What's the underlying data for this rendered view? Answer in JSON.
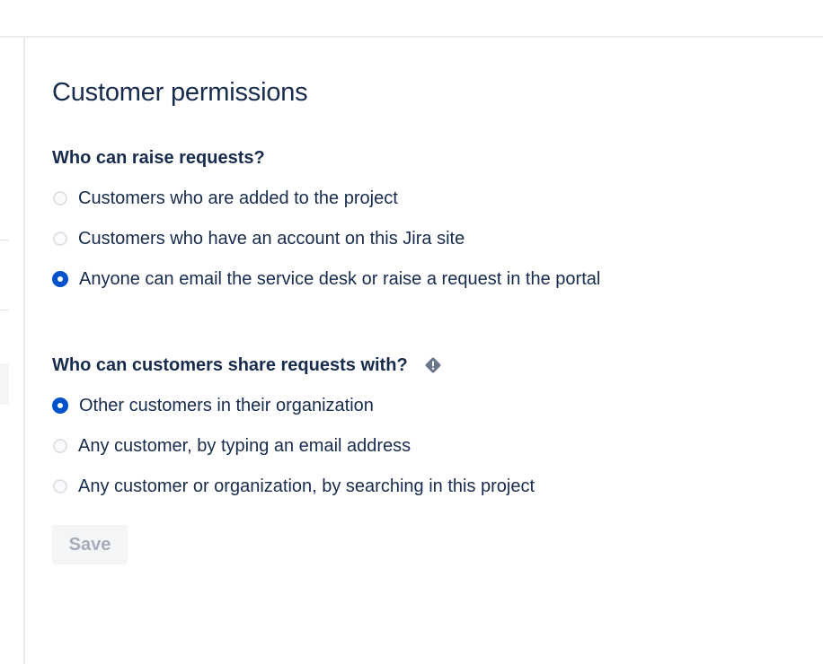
{
  "page": {
    "title": "Customer permissions"
  },
  "raise_requests": {
    "heading": "Who can raise requests?",
    "options": [
      {
        "label": "Customers who are added to the project",
        "selected": false
      },
      {
        "label": "Customers who have an account on this Jira site",
        "selected": false
      },
      {
        "label": "Anyone can email the service desk or raise a request in the portal",
        "selected": true
      }
    ]
  },
  "share_requests": {
    "heading": "Who can customers share requests with?",
    "heading_icon": "warning-diamond-icon",
    "options": [
      {
        "label": "Other customers in their organization",
        "selected": true
      },
      {
        "label": "Any customer, by typing an email address",
        "selected": false
      },
      {
        "label": "Any customer or organization, by searching in this project",
        "selected": false
      }
    ]
  },
  "actions": {
    "save_label": "Save",
    "save_disabled": true
  },
  "colors": {
    "text": "#172b4d",
    "accent": "#0052cc",
    "disabled_text": "#a5adba",
    "disabled_bg": "#f4f5f7",
    "warning_icon": "#6b778c"
  }
}
